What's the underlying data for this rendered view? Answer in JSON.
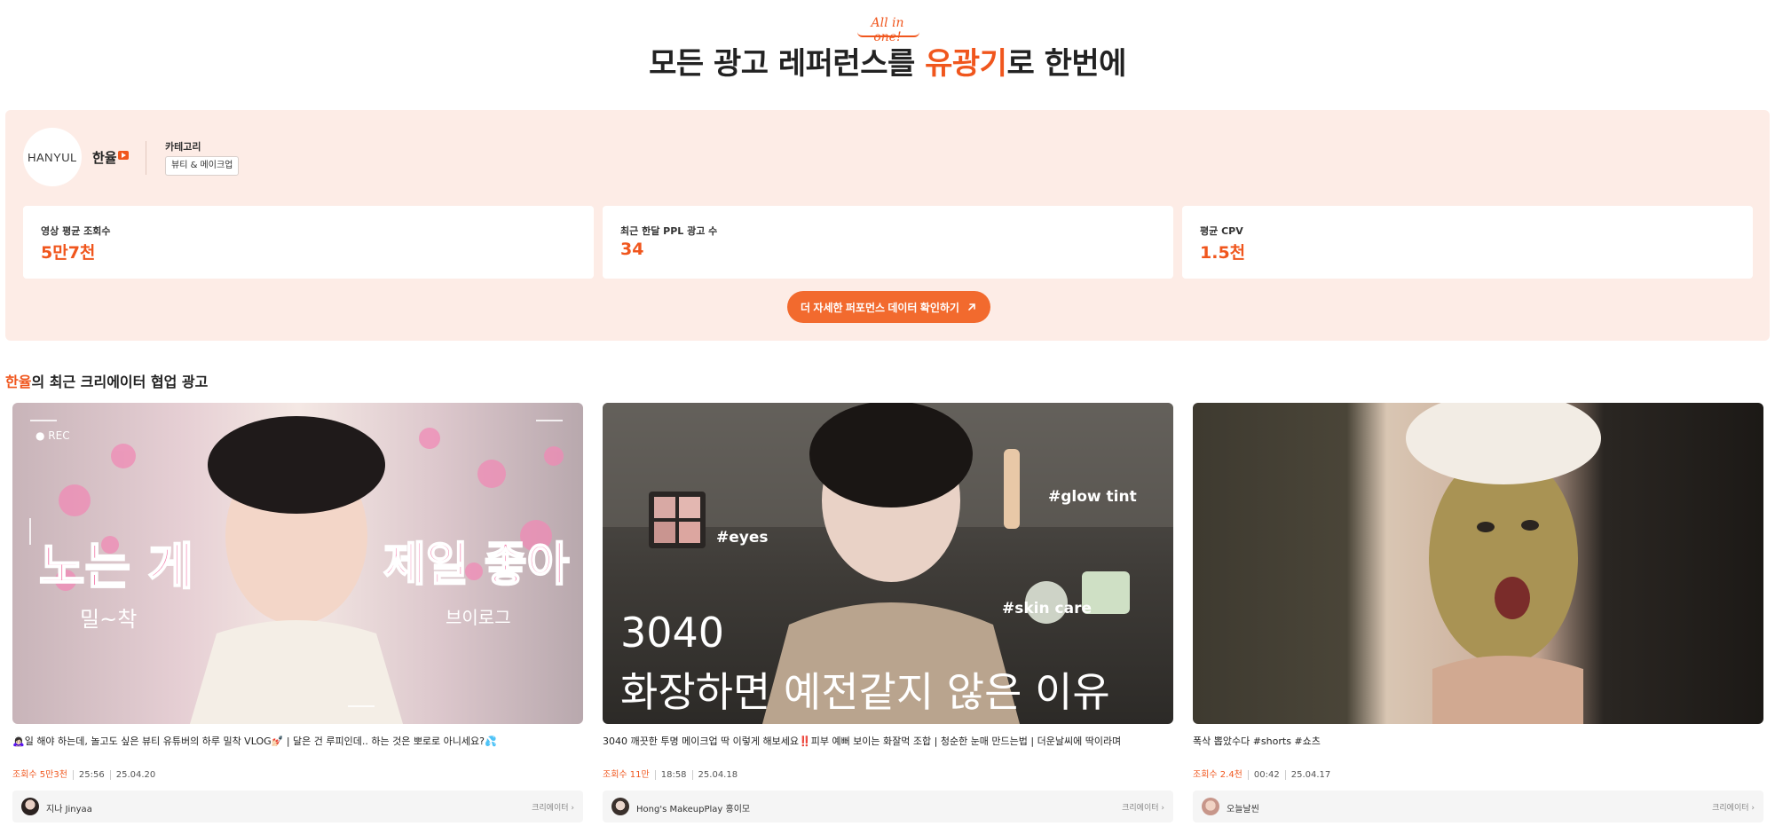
{
  "hero": {
    "tag": "All in one!",
    "title_before": "모든 광고 레퍼런스를 ",
    "title_accent": "유광기",
    "title_after": "로 한번에"
  },
  "channel": {
    "logo_text": "HANYUL",
    "name": "한율",
    "category_label": "카테고리",
    "category": "뷰티 & 메이크업"
  },
  "stats": [
    {
      "label": "영상 평균 조회수",
      "value": "5만7천"
    },
    {
      "label": "최근 한달 PPL 광고 수",
      "value": "34"
    },
    {
      "label": "평균 CPV",
      "value": "1.5천"
    }
  ],
  "cta_label": "더 자세한 퍼포먼스 데이터 확인하기",
  "section": {
    "accent": "한율",
    "title_rest": "의 최근 크리에이터 협업 광고"
  },
  "videos": [
    {
      "title": "🙇🏻‍♀️일 해야 하는데, 놀고도 싶은 뷰티 유튜버의 하루 밀착 VLOG💅🏻 | 달은 건 루피인데.. 하는 것은 뽀로로 아니세요?💦",
      "thumb_text_1": "노는 게",
      "thumb_text_2": "제일 좋아",
      "thumb_text_3": "밀~착",
      "thumb_text_4": "브이로그",
      "thumb_rec": "● REC",
      "views": "조회수 5만3천",
      "duration": "25:56",
      "date": "25.04.20",
      "creator": "지나 Jinyaa",
      "creator_link": "크리에이터 ›"
    },
    {
      "title": "3040 깨끗한 투명 메이크업 딱 이렇게 해보세요‼️피부 예뻐 보이는 화잘먹 조합 | 청순한 눈매 만드는법 | 더운날씨에 딱이라며",
      "thumb_text_1": "3040",
      "thumb_text_2": "화장하면 예전같지 않은 이유",
      "thumb_tag_1": "#eyes",
      "thumb_tag_2": "#glow tint",
      "thumb_tag_3": "#skin care",
      "views": "조회수 11만",
      "duration": "18:58",
      "date": "25.04.18",
      "creator": "Hong's MakeupPlay 홍이모",
      "creator_link": "크리에이터 ›"
    },
    {
      "title": "폭삭 뽑았수다 #shorts #쇼츠",
      "views": "조회수 2.4천",
      "duration": "00:42",
      "date": "25.04.17",
      "creator": "오늘날씬",
      "creator_link": "크리에이터 ›"
    }
  ],
  "colors": {
    "accent": "#f0561d",
    "panel_bg": "#fdece6",
    "cta_bg": "#f26a2e"
  }
}
